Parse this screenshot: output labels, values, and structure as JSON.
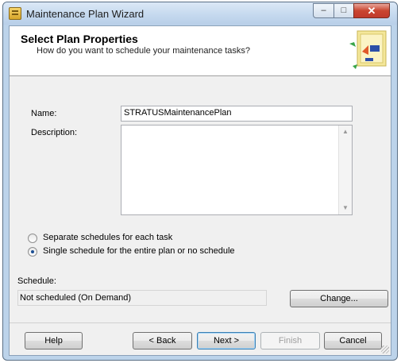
{
  "window": {
    "title": "Maintenance Plan Wizard"
  },
  "titlebar": {
    "minimize": "–",
    "maximize": "□",
    "close": "✕"
  },
  "header": {
    "title": "Select Plan Properties",
    "subtitle": "How do you want to schedule your maintenance tasks?"
  },
  "form": {
    "name_label": "Name:",
    "name_value": "STRATUSMaintenancePlan",
    "description_label": "Description:",
    "description_value": ""
  },
  "schedule_options": [
    {
      "label": "Separate schedules for each task",
      "checked": false
    },
    {
      "label": "Single schedule for the entire plan or no schedule",
      "checked": true
    }
  ],
  "schedule": {
    "label": "Schedule:",
    "value": "Not scheduled (On Demand)",
    "change_button": "Change..."
  },
  "footer": {
    "help": "Help",
    "back": "< Back",
    "next": "Next >",
    "finish": "Finish",
    "cancel": "Cancel"
  },
  "colors": {
    "titlebar": "#c4d8ee",
    "close": "#c9452f",
    "dialog": "#f0f0f0",
    "accent": "#1c4f94"
  },
  "icons": [
    "wizard-app-icon",
    "header-wizard-graphic",
    "scroll-up-icon",
    "scroll-down-icon",
    "resize-grip-icon"
  ]
}
